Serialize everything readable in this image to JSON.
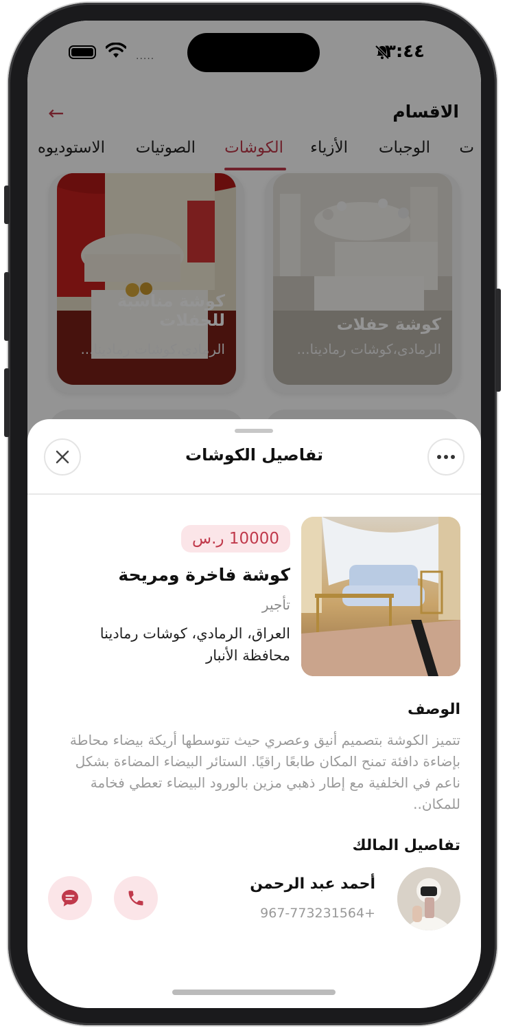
{
  "status_bar": {
    "time": "٣:٤٤",
    "signal_dots": "....."
  },
  "header": {
    "title": "الاقسام",
    "back_icon": "arrow-left-icon"
  },
  "tabs": [
    "ت",
    "الوجبات",
    "الأزياء",
    "الكوشات",
    "الصوتيات",
    "الاستوديوه"
  ],
  "active_tab": "الكوشات",
  "cards": [
    {
      "title": "كوشة حفلات",
      "subtitle": "الرمادى،كوشات رمادينا..."
    },
    {
      "title": "كوشة مناسبة للحفلات",
      "subtitle": "الرمادى،كوشات رمادينا..."
    }
  ],
  "sheet": {
    "title": "تفاصيل الكوشات",
    "more_icon": "ellipsis-icon",
    "close_icon": "close-icon",
    "item": {
      "price": "10000 ر.س",
      "name": "كوشة فاخرة ومريحة",
      "type": "تأجير",
      "location_line1": "العراق، الرمادي، كوشات رمادينا",
      "location_line2": "محافظة الأنبار"
    },
    "description_title": "الوصف",
    "description": "تتميز الكوشة بتصميم أنيق وعصري حيث تتوسطها أريكة بيضاء محاطة بإضاءة دافئة تمنح المكان طابعًا راقيًا. الستائر البيضاء المضاءة بشكل ناعم في الخلفية مع إطار ذهبي مزين بالورود البيضاء تعطي فخامة للمكان..",
    "owner_title": "تفاصيل المالك",
    "owner": {
      "name": "أحمد عبد الرحمن",
      "phone": "967-773231564+"
    },
    "accent": "#c0394b"
  }
}
